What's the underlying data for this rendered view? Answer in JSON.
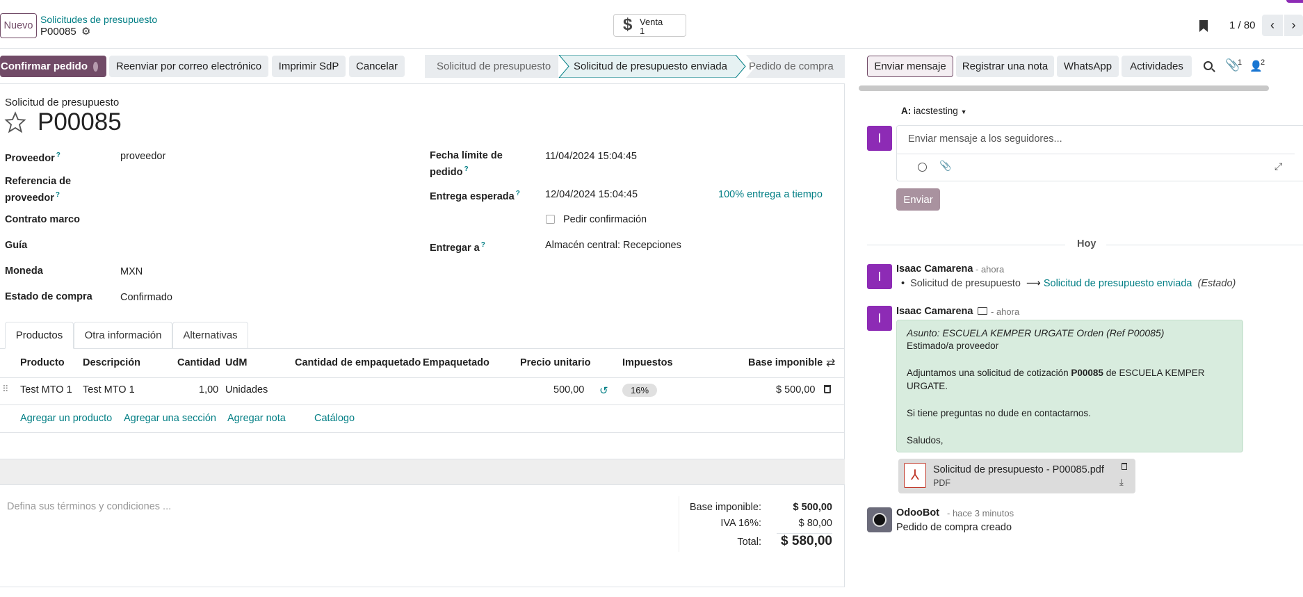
{
  "header": {
    "new_button": "Nuevo",
    "breadcrumb": "Solicitudes de presupuesto",
    "record_name": "P00085",
    "smart_button_label": "Venta",
    "smart_button_count": "1",
    "pager": "1 / 80"
  },
  "actions": {
    "confirm": "Confirmar pedido",
    "resend": "Reenviar por correo electrónico",
    "print": "Imprimir SdP",
    "cancel": "Cancelar"
  },
  "status": [
    "Solicitud de presupuesto",
    "Solicitud de presupuesto enviada",
    "Pedido de compra"
  ],
  "form": {
    "subtitle": "Solicitud de presupuesto",
    "title": "P00085",
    "supplier_label": "Proveedor",
    "supplier_value": "proveedor",
    "ref_label_1": "Referencia de",
    "ref_label_2": "proveedor",
    "contract_label": "Contrato marco",
    "guide_label": "Guía",
    "currency_label": "Moneda",
    "currency_value": "MXN",
    "state_label": "Estado de compra",
    "state_value": "Confirmado",
    "deadline_label_1": "Fecha límite de",
    "deadline_label_2": "pedido",
    "deadline_value": "11/04/2024 15:04:45",
    "expected_label": "Entrega esperada",
    "expected_value": "12/04/2024 15:04:45",
    "ontime": "100% entrega a tiempo",
    "confirm_checkbox": "Pedir confirmación",
    "deliver_label": "Entregar a",
    "deliver_value": "Almacén central: Recepciones"
  },
  "tabs": [
    "Productos",
    "Otra información",
    "Alternativas"
  ],
  "table": {
    "headers": [
      "Producto",
      "Descripción",
      "Cantidad",
      "UdM",
      "Cantidad de empaquetado",
      "Empaquetado",
      "Precio unitario",
      "Impuestos",
      "Base imponible"
    ],
    "row": {
      "product": "Test MTO 1",
      "description": "Test MTO 1",
      "qty": "1,00",
      "uom": "Unidades",
      "price": "500,00",
      "tax": "16%",
      "subtotal": "$ 500,00"
    },
    "add_product": "Agregar un producto",
    "add_section": "Agregar una sección",
    "add_note": "Agregar nota",
    "catalog": "Catálogo"
  },
  "terms_placeholder": "Defina sus términos y condiciones ...",
  "totals": {
    "base_label": "Base imponible:",
    "base_value": "$ 500,00",
    "iva_label": "IVA 16%:",
    "iva_value": "$ 80,00",
    "total_label": "Total:",
    "total_value": "$ 580,00"
  },
  "chatter": {
    "send_message": "Enviar mensaje",
    "log_note": "Registrar una nota",
    "whatsapp": "WhatsApp",
    "activities": "Actividades",
    "attachments_count": "1",
    "followers_count": "2",
    "to_label": "A:",
    "to_value": "iacstesting",
    "composer_placeholder": "Enviar mensaje a los seguidores...",
    "send_button": "Enviar",
    "today": "Hoy",
    "avatar_letter": "I",
    "msg1": {
      "author": "Isaac Camarena",
      "time": "- ahora",
      "from": "Solicitud de presupuesto",
      "to": "Solicitud de presupuesto enviada",
      "field": "(Estado)"
    },
    "msg2": {
      "author": "Isaac Camarena",
      "time": "- ahora",
      "subject": "Asunto: ESCUELA KEMPER URGATE Orden (Ref P00085)",
      "line1": "Estimado/a proveedor",
      "line2a": "Adjuntamos una solicitud de cotización ",
      "line2b": "P00085",
      "line2c": " de ESCUELA KEMPER",
      "line3": "URGATE.",
      "line4": "Si tiene preguntas no dude en contactarnos.",
      "line5": "Saludos,",
      "attachment_name": "Solicitud de presupuesto - P00085.pdf",
      "attachment_type": "PDF"
    },
    "msg3": {
      "author": "OdooBot",
      "time": "- hace 3 minutos",
      "body": "Pedido de compra creado"
    }
  }
}
